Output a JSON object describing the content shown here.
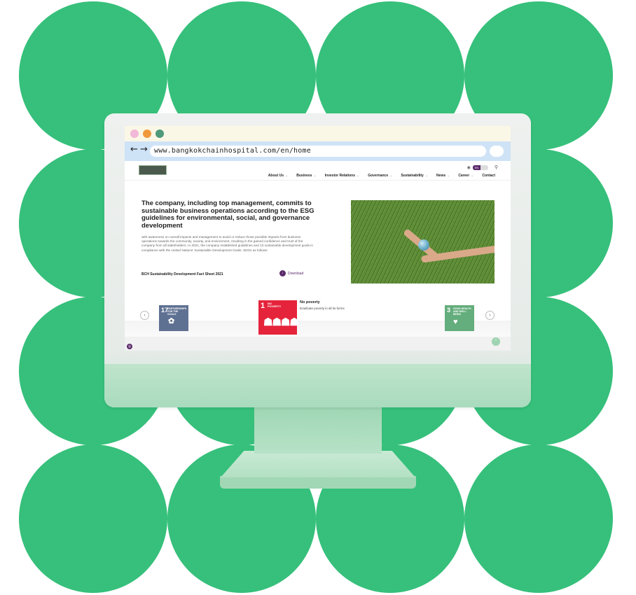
{
  "colors": {
    "background_green": "#36c07b",
    "brand_purple": "#5b2a6b",
    "sdg17": "#5f7192",
    "sdg1": "#e5243b",
    "sdg3": "#64ad7c"
  },
  "browser": {
    "back_icon": "arrow-left-icon",
    "forward_icon": "arrow-right-icon",
    "url": "www.bangkokchainhospital.com/en/home"
  },
  "header": {
    "language": "EN",
    "menu": [
      {
        "label": "About Us"
      },
      {
        "label": "Business"
      },
      {
        "label": "Investor Relations"
      },
      {
        "label": "Governance"
      },
      {
        "label": "Sustainability"
      },
      {
        "label": "News"
      },
      {
        "label": "Career"
      },
      {
        "label": "Contact"
      }
    ]
  },
  "hero": {
    "title": "The company, including top management, commits to sustainable business operations according to the ESG guidelines for environmental, social, and governance development",
    "body": "with awareness on overall impacts and management to avoid or reduce those possible impacts from business operations towards the community, society, and environment, resulting in the gained confidence and trust of the company from all stakeholders. In 2021, the company established guidelines and 13 sustainable development goals in compliance with the United Nations' Sustainable Development Goals: SDGs as follows:",
    "fact_sheet_label": "BCH Sustainability Development Fact Sheet 2021",
    "download_label": "Download"
  },
  "carousel": {
    "prev_icon": "chevron-left-icon",
    "next_icon": "chevron-right-icon",
    "tiles": [
      {
        "number": "17",
        "text": "PARTNERSHIPS FOR THE GOALS"
      },
      {
        "number": "1",
        "text": "NO POVERTY"
      },
      {
        "number": "3",
        "text": "GOOD HEALTH AND WELL-BEING"
      }
    ],
    "active_goal_title": "No poverty",
    "active_goal_desc": "Eradicate poverty in all its forms"
  }
}
